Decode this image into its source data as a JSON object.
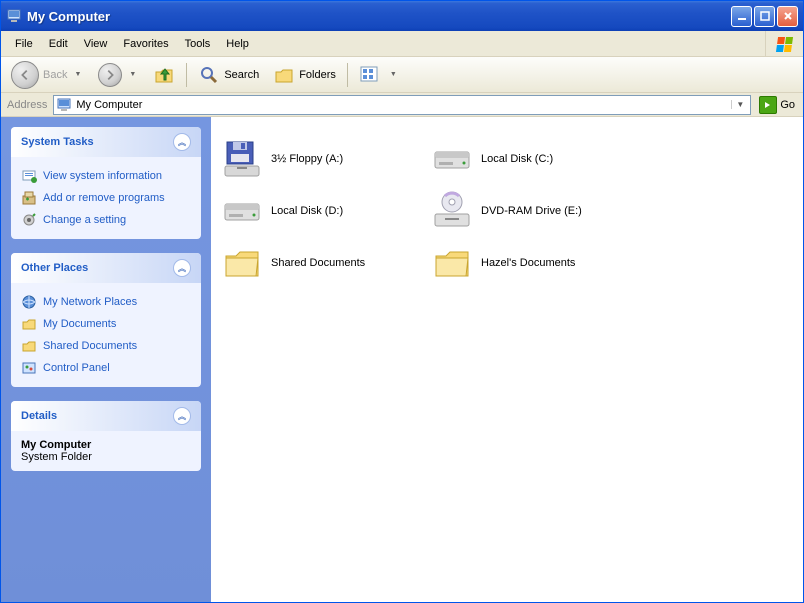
{
  "window": {
    "title": "My Computer"
  },
  "menu": {
    "file": "File",
    "edit": "Edit",
    "view": "View",
    "favorites": "Favorites",
    "tools": "Tools",
    "help": "Help"
  },
  "toolbar": {
    "back": "Back",
    "search": "Search",
    "folders": "Folders"
  },
  "address": {
    "label": "Address",
    "value": "My Computer",
    "go": "Go"
  },
  "sidebar": {
    "system_tasks": {
      "title": "System Tasks",
      "items": [
        {
          "label": "View system information",
          "icon": "info-icon"
        },
        {
          "label": "Add or remove programs",
          "icon": "programs-icon"
        },
        {
          "label": "Change a setting",
          "icon": "settings-icon"
        }
      ]
    },
    "other_places": {
      "title": "Other Places",
      "items": [
        {
          "label": "My Network Places",
          "icon": "network-icon"
        },
        {
          "label": "My Documents",
          "icon": "folder-icon"
        },
        {
          "label": "Shared Documents",
          "icon": "folder-icon"
        },
        {
          "label": "Control Panel",
          "icon": "control-icon"
        }
      ]
    },
    "details": {
      "title": "Details",
      "name": "My Computer",
      "type": "System Folder"
    }
  },
  "items": [
    {
      "label": "3½ Floppy (A:)",
      "icon": "floppy-icon"
    },
    {
      "label": "Local Disk (C:)",
      "icon": "disk-icon"
    },
    {
      "label": "Local Disk (D:)",
      "icon": "disk-icon"
    },
    {
      "label": "DVD-RAM Drive (E:)",
      "icon": "dvd-icon"
    },
    {
      "label": "Shared Documents",
      "icon": "folder-large-icon"
    },
    {
      "label": "Hazel's Documents",
      "icon": "folder-large-icon"
    }
  ],
  "colors": {
    "accent": "#215dc6",
    "titlebar": "#1f53c7"
  }
}
